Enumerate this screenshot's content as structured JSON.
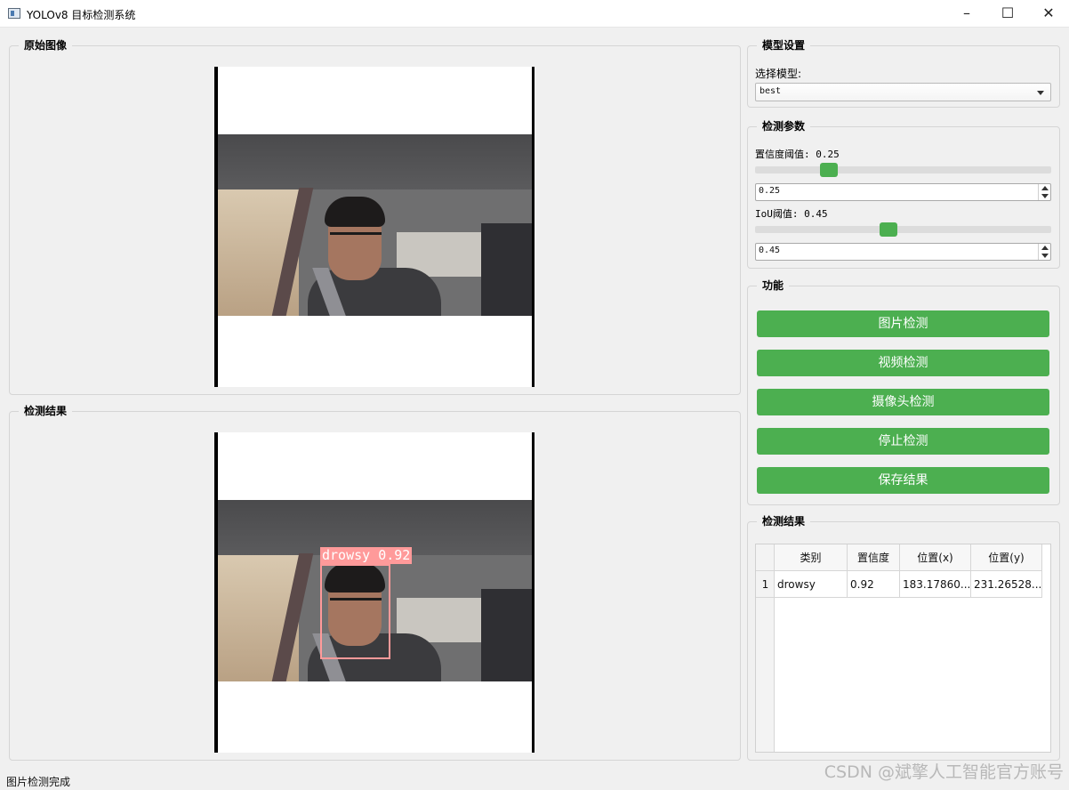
{
  "window": {
    "title": "YOLOv8 目标检测系统",
    "minimize": "–",
    "maximize": "☐",
    "close": "✕"
  },
  "original": {
    "title": "原始图像"
  },
  "result_image": {
    "title": "检测结果",
    "detection_label": "drowsy 0.92"
  },
  "model": {
    "title": "模型设置",
    "select_label": "选择模型:",
    "selected": "best"
  },
  "params": {
    "title": "检测参数",
    "conf_label": "置信度阈值: 0.25",
    "conf_value": "0.25",
    "conf_level": 0.25,
    "iou_label": "IoU阈值: 0.45",
    "iou_value": "0.45",
    "iou_level": 0.45
  },
  "functions": {
    "title": "功能",
    "image_detect": "图片检测",
    "video_detect": "视频检测",
    "camera_detect": "摄像头检测",
    "stop_detect": "停止检测",
    "save_result": "保存结果"
  },
  "results_table": {
    "title": "检测结果",
    "headers": [
      "类别",
      "置信度",
      "位置(x)",
      "位置(y)"
    ],
    "rows": [
      {
        "index": "1",
        "class": "drowsy",
        "confidence": "0.92",
        "x": "183.17860...",
        "y": "231.26528..."
      }
    ]
  },
  "status": {
    "text": "图片检测完成"
  },
  "watermark": "CSDN @斌擎人工智能官方账号",
  "colors": {
    "accent": "#4caf50",
    "bbox": "#ff9a9a"
  }
}
